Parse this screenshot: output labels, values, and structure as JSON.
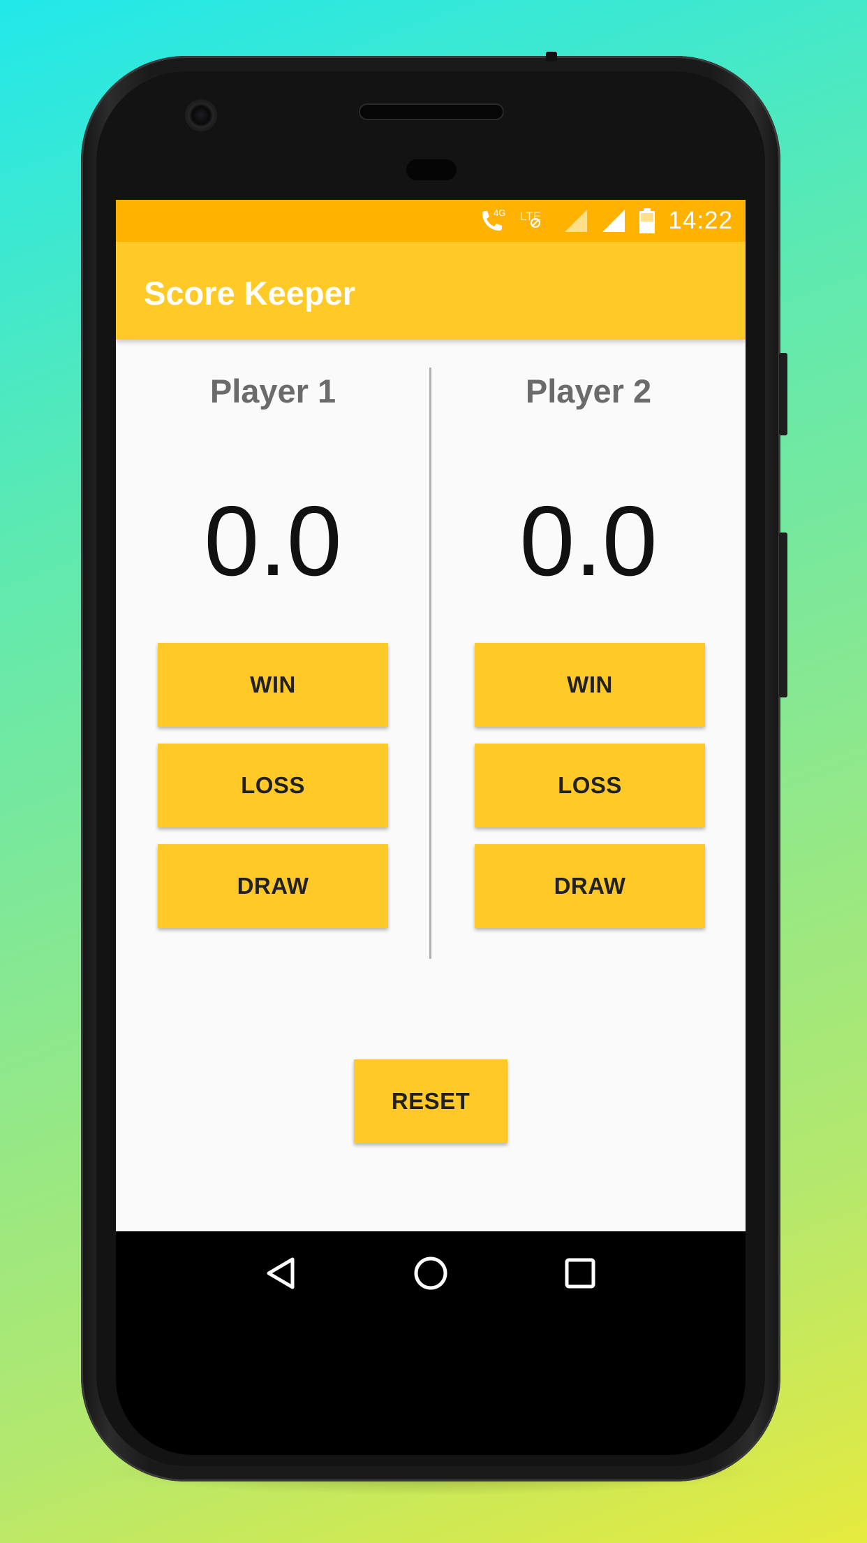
{
  "status_bar": {
    "time": "14:22",
    "icons": [
      "wifi-calling-4g-icon",
      "lte-off-icon",
      "signal-weak-icon",
      "signal-full-icon",
      "battery-charging-icon"
    ],
    "color": "#ffb300"
  },
  "app_bar": {
    "title": "Score Keeper",
    "color": "#ffca28"
  },
  "players": [
    {
      "name": "Player 1",
      "score": "0.0",
      "buttons": {
        "win": "WIN",
        "loss": "LOSS",
        "draw": "DRAW"
      }
    },
    {
      "name": "Player 2",
      "score": "0.0",
      "buttons": {
        "win": "WIN",
        "loss": "LOSS",
        "draw": "DRAW"
      }
    }
  ],
  "reset_label": "RESET",
  "nav": {
    "icons": [
      "back-icon",
      "home-icon",
      "recents-icon"
    ]
  },
  "colors": {
    "accent": "#ffca28",
    "status": "#ffb300",
    "background": "#fafafa"
  }
}
